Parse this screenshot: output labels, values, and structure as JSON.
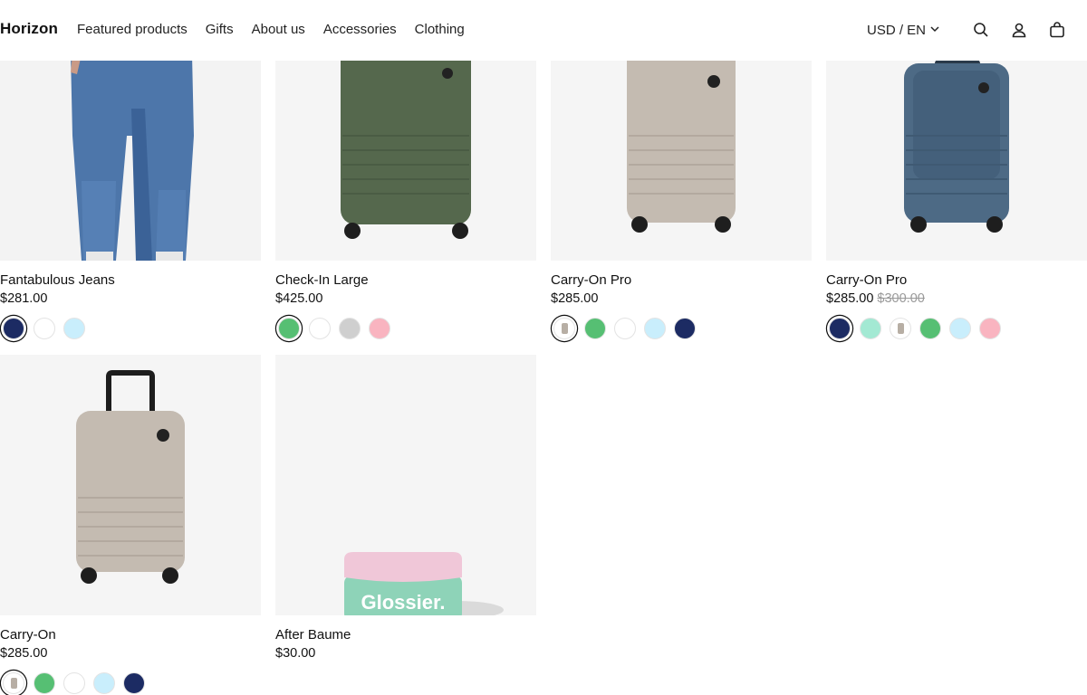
{
  "brand": "Horizon",
  "nav": [
    "Featured products",
    "Gifts",
    "About us",
    "Accessories",
    "Clothing"
  ],
  "header": {
    "currency_label": "USD / EN",
    "icons": [
      "chevron-down-icon",
      "search-icon",
      "account-icon",
      "cart-icon"
    ]
  },
  "products": [
    {
      "title": "Fantabulous Jeans",
      "price": "$281.00",
      "compare_price": "",
      "swatches": [
        {
          "color": "#1c2b63",
          "selected": true
        },
        {
          "color": "#ffffff",
          "selected": false
        },
        {
          "color": "#c9eefc",
          "selected": false
        }
      ]
    },
    {
      "title": "Check-In Large",
      "price": "$425.00",
      "compare_price": "",
      "swatches": [
        {
          "color": "#56bf73",
          "selected": true
        },
        {
          "color": "#ffffff",
          "selected": false
        },
        {
          "color": "#cfcfcf",
          "selected": false
        },
        {
          "color": "#f9b4c0",
          "selected": false
        }
      ]
    },
    {
      "title": "Carry-On Pro",
      "price": "$285.00",
      "compare_price": "",
      "swatches": [
        {
          "color": "image",
          "selected": true
        },
        {
          "color": "#56bf73",
          "selected": false
        },
        {
          "color": "#ffffff",
          "selected": false
        },
        {
          "color": "#c9eefc",
          "selected": false
        },
        {
          "color": "#1c2b63",
          "selected": false
        }
      ]
    },
    {
      "title": "Carry-On Pro",
      "price": "$285.00",
      "compare_price": "$300.00",
      "swatches": [
        {
          "color": "#1c2b63",
          "selected": true
        },
        {
          "color": "#a3e9d3",
          "selected": false
        },
        {
          "color": "image",
          "selected": false
        },
        {
          "color": "#56bf73",
          "selected": false
        },
        {
          "color": "#c9eefc",
          "selected": false
        },
        {
          "color": "#f9b4c0",
          "selected": false
        }
      ]
    },
    {
      "title": "Carry-On",
      "price": "$285.00",
      "compare_price": "",
      "swatches": [
        {
          "color": "image",
          "selected": true
        },
        {
          "color": "#56bf73",
          "selected": false
        },
        {
          "color": "#ffffff",
          "selected": false
        },
        {
          "color": "#c9eefc",
          "selected": false
        },
        {
          "color": "#1c2b63",
          "selected": false
        }
      ]
    },
    {
      "title": "After Baume",
      "price": "$30.00",
      "compare_price": "",
      "swatches": [],
      "product_text": "Glossier."
    }
  ]
}
